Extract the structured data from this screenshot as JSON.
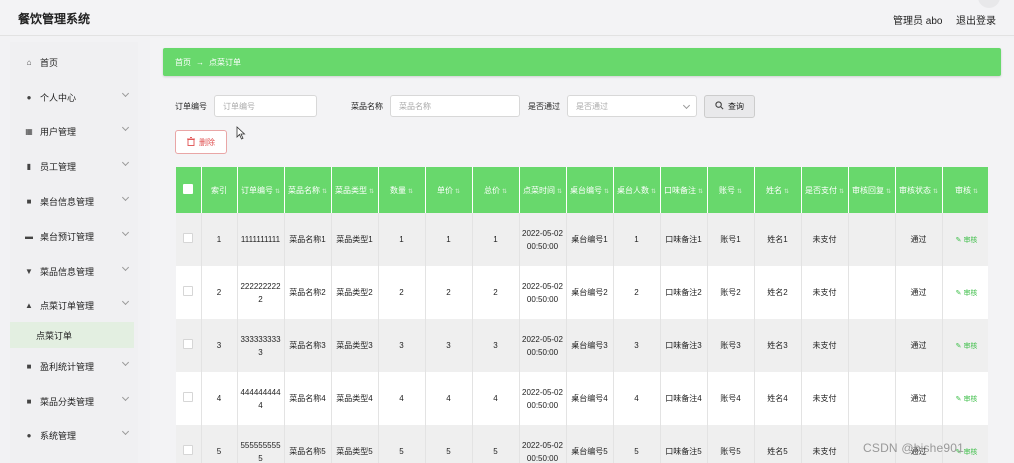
{
  "app": {
    "title": "餐饮管理系统"
  },
  "header": {
    "user": "管理员 abo",
    "logout": "退出登录"
  },
  "sidebar": {
    "items": [
      {
        "label": "首页",
        "icon": "home-icon",
        "glyph": "⌂"
      },
      {
        "label": "个人中心",
        "icon": "person-icon",
        "glyph": "●"
      },
      {
        "label": "用户管理",
        "icon": "user-grid-icon",
        "glyph": "▦"
      },
      {
        "label": "员工管理",
        "icon": "bar-chart-icon",
        "glyph": "▮"
      },
      {
        "label": "桌台信息管理",
        "icon": "grid-icon",
        "glyph": "■"
      },
      {
        "label": "桌台预订管理",
        "icon": "monitor-icon",
        "glyph": "▬"
      },
      {
        "label": "菜品信息管理",
        "icon": "funnel-icon",
        "glyph": "▼"
      },
      {
        "label": "点菜订单管理",
        "icon": "bank-icon",
        "glyph": "▲"
      },
      {
        "label": "盈利统计管理",
        "icon": "grid-icon",
        "glyph": "■"
      },
      {
        "label": "菜品分类管理",
        "icon": "grid-icon",
        "glyph": "■"
      },
      {
        "label": "系统管理",
        "icon": "person-icon",
        "glyph": "●"
      }
    ],
    "sub_item": "点菜订单"
  },
  "breadcrumb": {
    "home": "首页",
    "arrow": "→",
    "current": "点菜订单"
  },
  "filters": {
    "order_no_label": "订单编号",
    "order_no_placeholder": "订单编号",
    "dish_name_label": "菜品名称",
    "dish_name_placeholder": "菜品名称",
    "approved_label": "是否通过",
    "approved_placeholder": "是否通过",
    "search_label": "查询",
    "search_icon": "magnifier-icon"
  },
  "actions": {
    "delete_label": "删除",
    "delete_icon": "trash-icon"
  },
  "table": {
    "headers": [
      "索引",
      "订单编号",
      "菜品名称",
      "菜品类型",
      "数量",
      "单价",
      "总价",
      "点菜时间",
      "桌台编号",
      "桌台人数",
      "口味备注",
      "账号",
      "姓名",
      "是否支付",
      "审核回复",
      "审核状态",
      "审核"
    ],
    "rows": [
      [
        "1",
        "1111111111",
        "菜品名称1",
        "菜品类型1",
        "1",
        "1",
        "1",
        "2022-05-02 00:50:00",
        "桌台编号1",
        "1",
        "口味备注1",
        "账号1",
        "姓名1",
        "未支付",
        "",
        "通过",
        "审核"
      ],
      [
        "2",
        "2222222222",
        "菜品名称2",
        "菜品类型2",
        "2",
        "2",
        "2",
        "2022-05-02 00:50:00",
        "桌台编号2",
        "2",
        "口味备注2",
        "账号2",
        "姓名2",
        "未支付",
        "",
        "通过",
        "审核"
      ],
      [
        "3",
        "3333333333",
        "菜品名称3",
        "菜品类型3",
        "3",
        "3",
        "3",
        "2022-05-02 00:50:00",
        "桌台编号3",
        "3",
        "口味备注3",
        "账号3",
        "姓名3",
        "未支付",
        "",
        "通过",
        "审核"
      ],
      [
        "4",
        "4444444444",
        "菜品名称4",
        "菜品类型4",
        "4",
        "4",
        "4",
        "2022-05-02 00:50:00",
        "桌台编号4",
        "4",
        "口味备注4",
        "账号4",
        "姓名4",
        "未支付",
        "",
        "通过",
        "审核"
      ],
      [
        "5",
        "5555555555",
        "菜品名称5",
        "菜品类型5",
        "5",
        "5",
        "5",
        "2022-05-02 00:50:00",
        "桌台编号5",
        "5",
        "口味备注5",
        "账号5",
        "姓名5",
        "未支付",
        "",
        "通过",
        "审核"
      ]
    ]
  },
  "watermark": "CSDN @bishe901",
  "colors": {
    "accent": "#68d86c",
    "danger": "#e05050",
    "link": "#3fbf4a"
  }
}
